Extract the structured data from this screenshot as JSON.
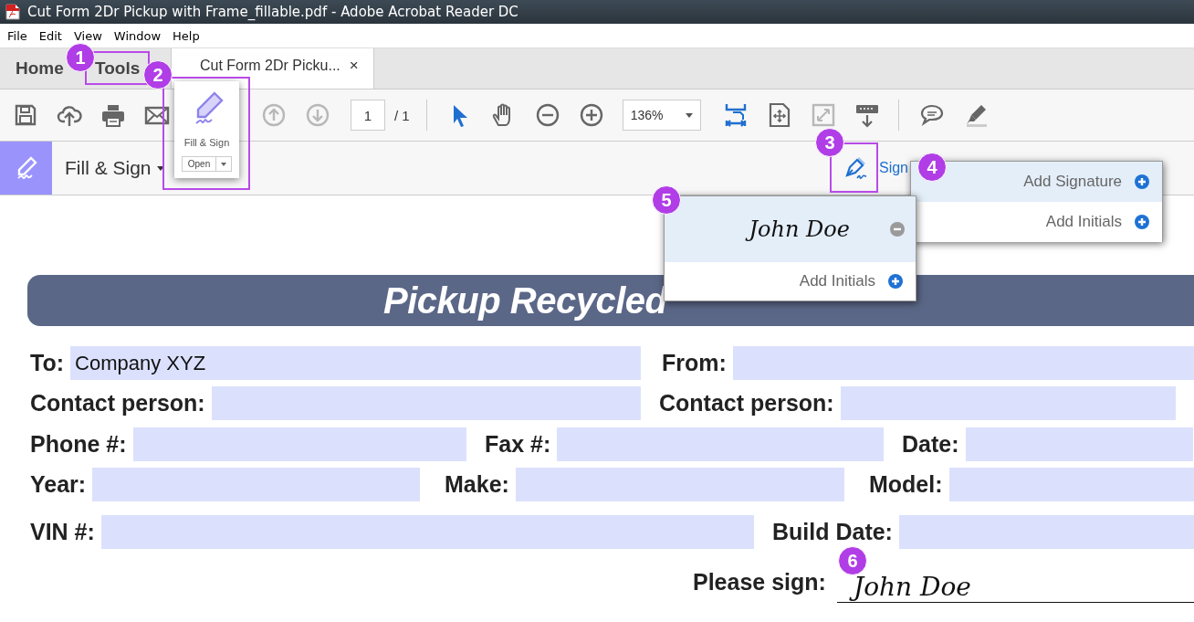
{
  "window": {
    "title": "Cut Form 2Dr Pickup with Frame_fillable.pdf - Adobe Acrobat Reader DC"
  },
  "menu": [
    "File",
    "Edit",
    "View",
    "Window",
    "Help"
  ],
  "tabs": [
    {
      "label": "Home",
      "selected": false,
      "kind": "nav"
    },
    {
      "label": "Tools",
      "selected": false,
      "kind": "nav"
    },
    {
      "label": "Cut Form 2Dr Picku...",
      "selected": true,
      "kind": "document",
      "close": "×"
    }
  ],
  "toolbar": {
    "page_number": "1",
    "page_total": "/ 1",
    "zoom": "136%"
  },
  "tools_popup": {
    "label": "Fill & Sign",
    "button": "Open"
  },
  "fill_sign_bar": {
    "title": "Fill & Sign",
    "sign": "Sign"
  },
  "sign_menu": [
    {
      "label": "Add Signature",
      "selected": true
    },
    {
      "label": "Add Initials",
      "selected": false
    }
  ],
  "signature_menu": [
    {
      "kind": "signature",
      "text": "John Doe",
      "selected": true
    },
    {
      "kind": "action",
      "text": "Add Initials",
      "selected": false
    }
  ],
  "form": {
    "title": "Pickup Recycled",
    "rows": [
      {
        "fields": [
          {
            "label": "To:",
            "value": "Company XYZ"
          },
          {
            "label": "From:"
          }
        ]
      },
      {
        "fields": [
          {
            "label": "Contact person:"
          },
          {
            "label": "Contact person:"
          }
        ]
      },
      {
        "fields": [
          {
            "label": "Phone #:"
          },
          {
            "label": "Fax #:"
          },
          {
            "label": "Date:"
          }
        ]
      },
      {
        "fields": [
          {
            "label": "Year:"
          },
          {
            "label": "Make:"
          },
          {
            "label": "Model:"
          }
        ]
      },
      {
        "fields": [
          {
            "label": "VIN #:"
          },
          {
            "label": "Build Date:"
          }
        ]
      }
    ],
    "signature": {
      "label": "Please sign:",
      "value": "John Doe"
    }
  },
  "callouts": [
    {
      "number": "1",
      "boxed": true
    },
    {
      "number": "2",
      "boxed": true
    },
    {
      "number": "3",
      "boxed": true
    },
    {
      "number": "4",
      "boxed": false
    },
    {
      "number": "5",
      "boxed": false
    },
    {
      "number": "6",
      "boxed": false
    }
  ]
}
